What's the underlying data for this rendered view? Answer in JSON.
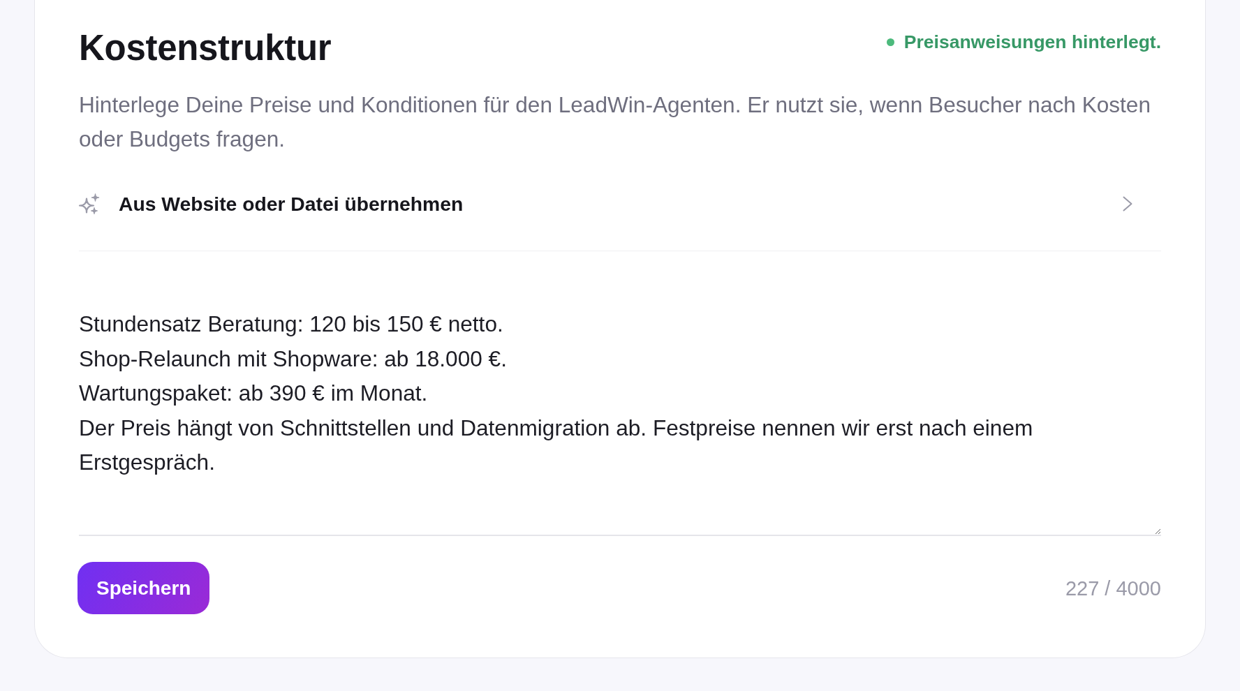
{
  "title": "Kostenstruktur",
  "status": {
    "kind": "success",
    "label": "Preisanweisungen hinterlegt."
  },
  "description": "Hinterlege Deine Preise und Konditionen für den LeadWin-Agenten. Er nutzt sie, wenn Besucher nach Kosten oder Budgets fragen.",
  "import_action": {
    "label": "Aus Website oder Datei übernehmen"
  },
  "pricing_text": {
    "value": "Stundensatz Beratung: 120 bis 150 € netto.\nShop-Relaunch mit Shopware: ab 18.000 €.\nWartungspaket: ab 390 € im Monat.\nDer Preis hängt von Schnittstellen und Datenmigration ab. Festpreise nennen wir erst nach einem Erstgespräch."
  },
  "save_button": {
    "label": "Speichern"
  },
  "char_count": "227 / 4000"
}
